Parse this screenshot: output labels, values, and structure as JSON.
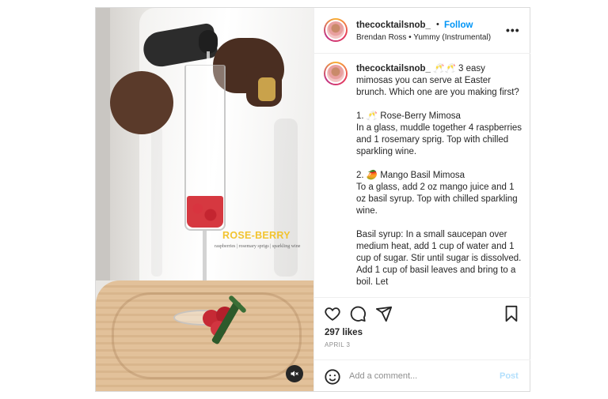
{
  "header": {
    "username": "thecocktailsnob_",
    "separator": "•",
    "follow_label": "Follow",
    "subtitle": "Brendan Ross • Yummy (Instrumental)",
    "more_label": "•••"
  },
  "media": {
    "overlay_title": "ROSE-BERRY",
    "overlay_subtitle": "raspberries | rosemary sprigs | sparkling wine"
  },
  "caption": {
    "username": "thecocktailsnob_",
    "text": " 🥂🥂 3 easy mimosas you can serve at Easter brunch. Which one are you making first?\n\n1. 🥂 Rose-Berry Mimosa\nIn a glass, muddle together 4 raspberries and 1 rosemary sprig. Top with chilled sparkling wine.\n\n2. 🥭 Mango Basil Mimosa\nTo a glass, add 2 oz mango juice and 1 oz basil syrup. Top with chilled sparkling wine.\n\nBasil syrup: In a small saucepan over medium heat, add 1 cup of water and 1 cup of sugar. Stir until sugar is dissolved. Add 1 cup of basil leaves and bring to a boil. Let"
  },
  "actions": {
    "likes": "297 likes",
    "date": "APRIL 3"
  },
  "comment": {
    "placeholder": "Add a comment...",
    "post_label": "Post"
  },
  "icons": {
    "like": "heart-icon",
    "comment": "comment-icon",
    "share": "share-icon",
    "save": "bookmark-icon",
    "emoji": "emoji-icon",
    "mute": "mute-icon"
  },
  "colors": {
    "follow": "#0095f6",
    "post_disabled": "#b2dffc",
    "overlay_title": "#f2c430"
  }
}
